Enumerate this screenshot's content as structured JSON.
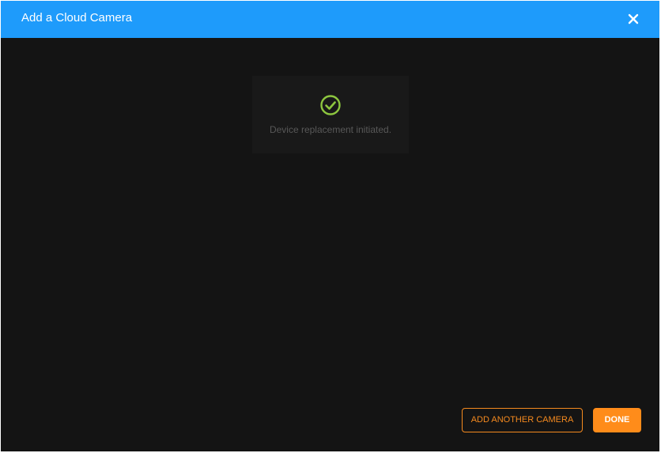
{
  "dialog": {
    "title": "Add a Cloud Camera",
    "close_icon": "close-icon"
  },
  "toast": {
    "icon": "check-circle-icon",
    "message": "Device replacement initiated."
  },
  "actions": {
    "add_another_label": "ADD ANOTHER CAMERA",
    "done_label": "DONE"
  },
  "colors": {
    "header_bg": "#1e9bfb",
    "body_bg": "#141414",
    "accent": "#ff8c1a",
    "success": "#8dc63f"
  }
}
